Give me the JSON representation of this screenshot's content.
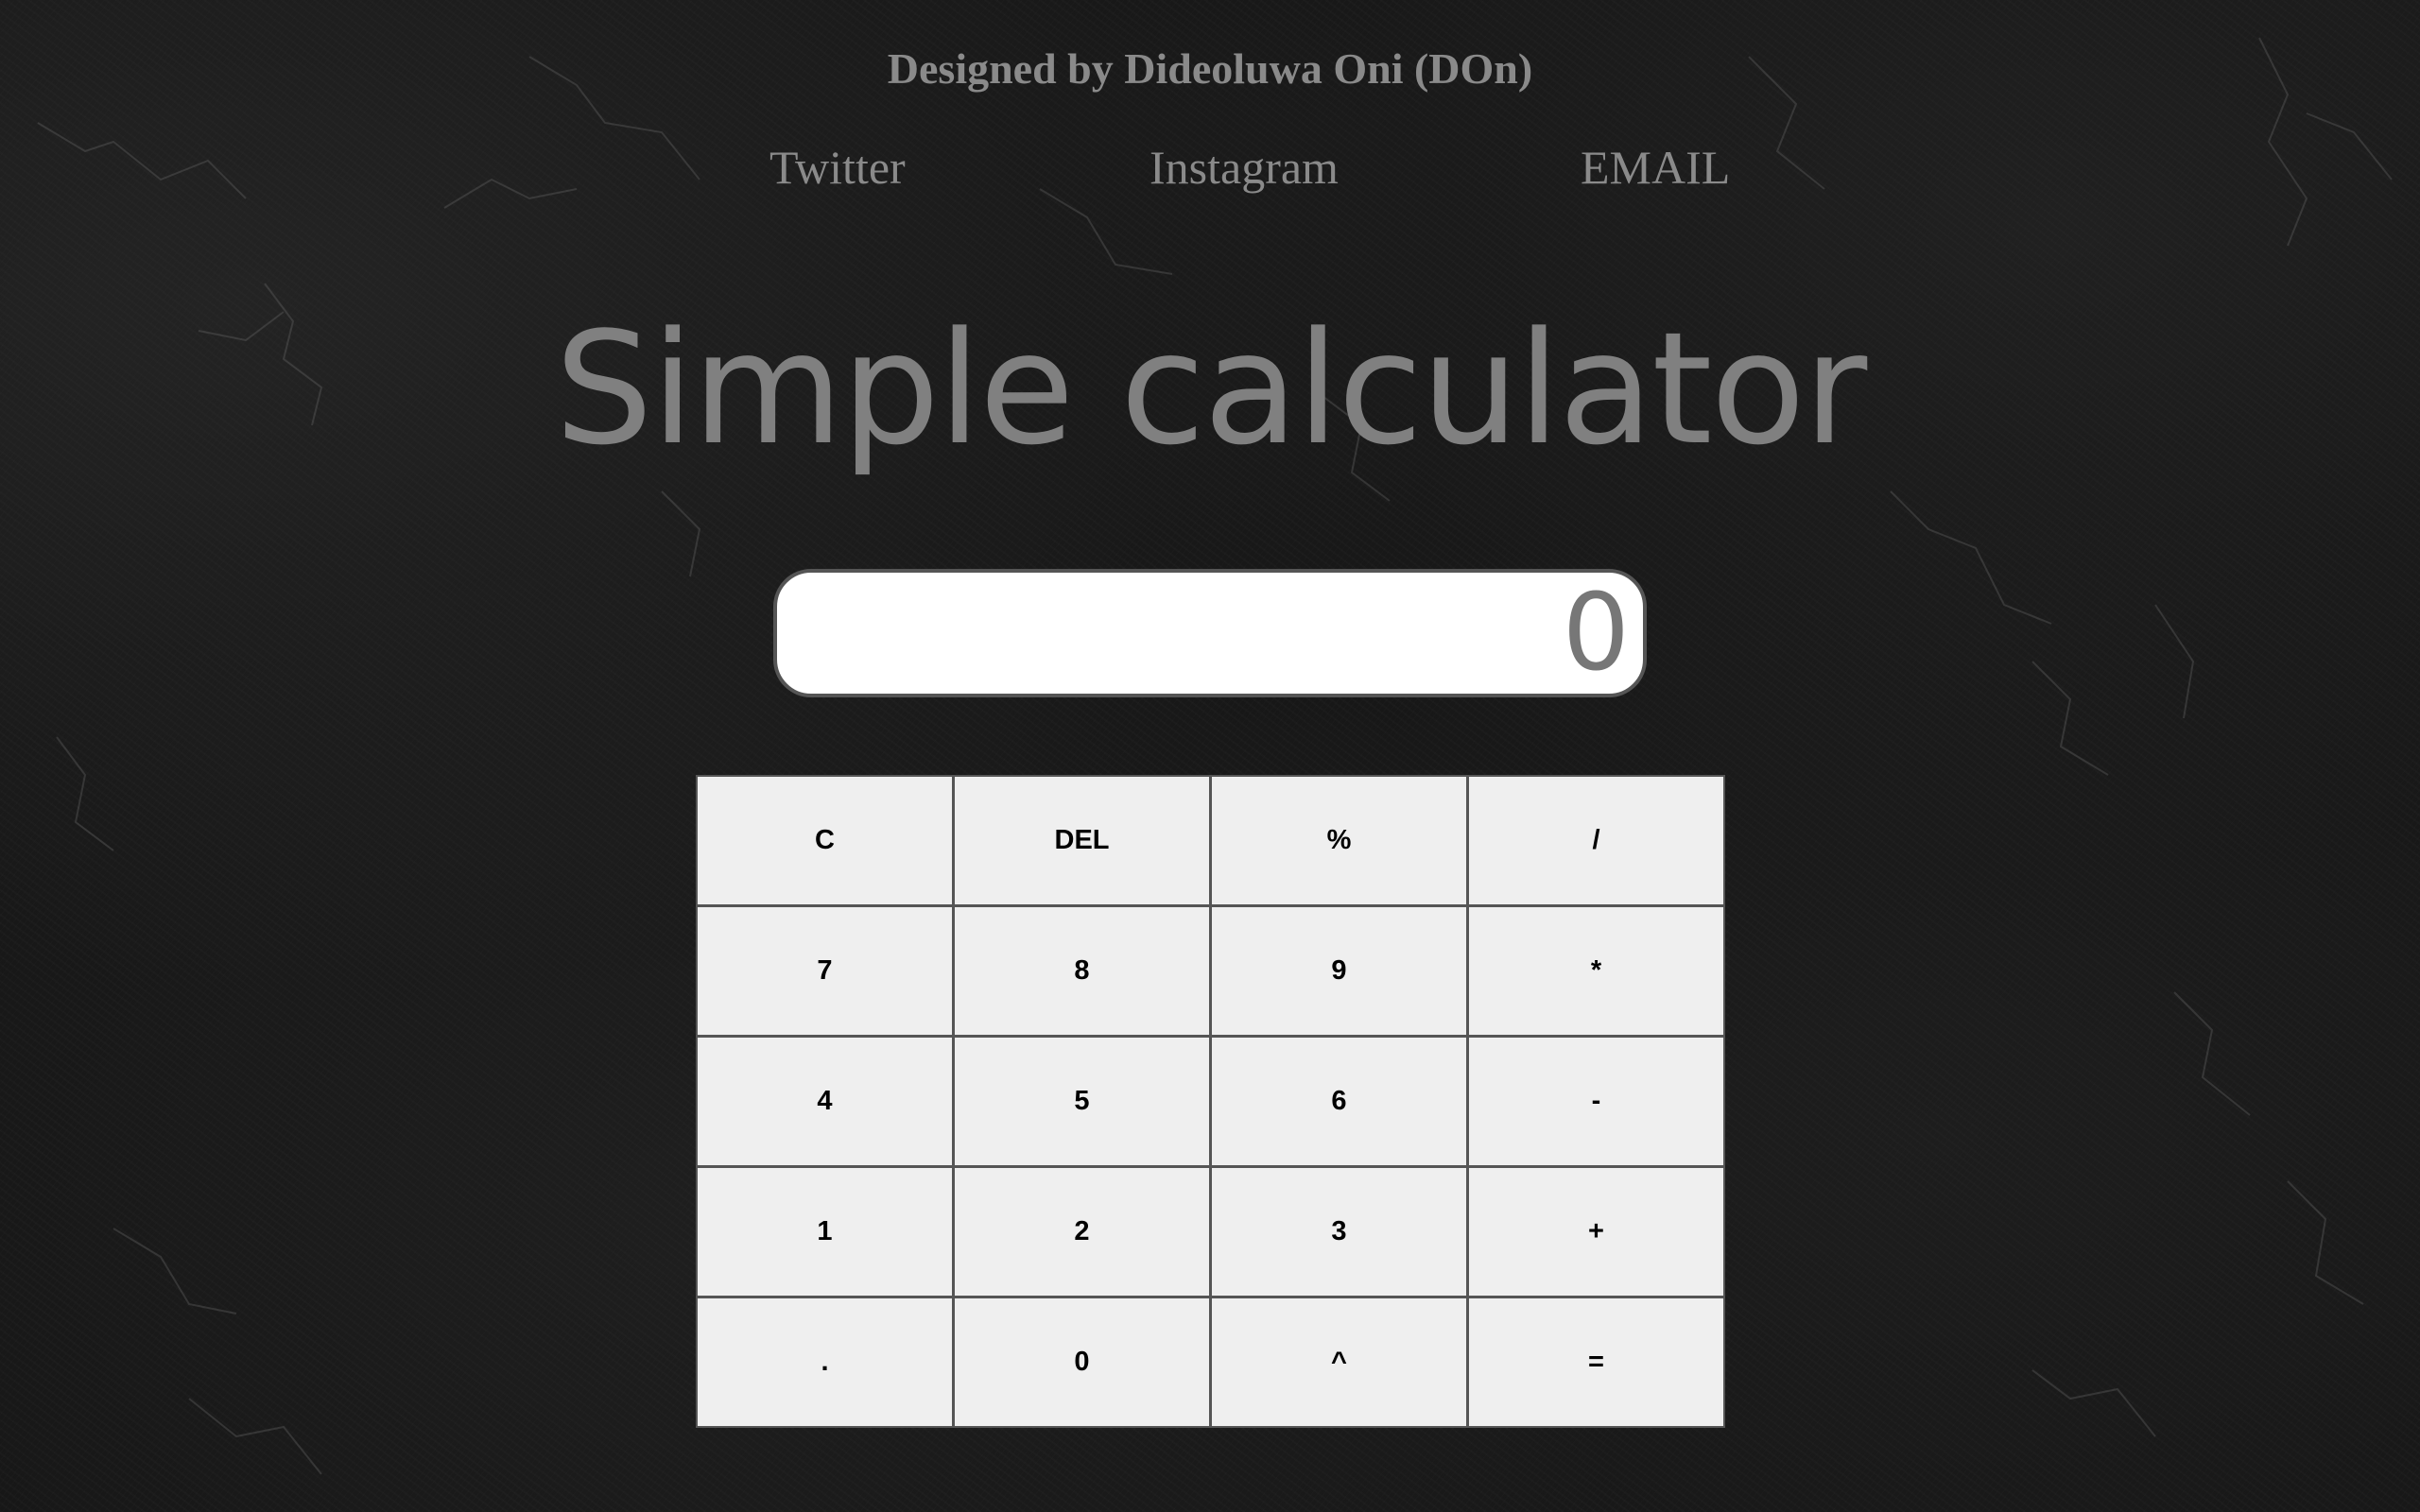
{
  "header": {
    "credit": "Designed by Dideoluwa Oni (DOn)",
    "links": {
      "twitter": "Twitter",
      "instagram": "Instagram",
      "email": "EMAIL"
    }
  },
  "main": {
    "title": "Simple calculator",
    "display_value": "0"
  },
  "keypad": {
    "keys": [
      [
        "C",
        "DEL",
        "%",
        "/"
      ],
      [
        "7",
        "8",
        "9",
        "*"
      ],
      [
        "4",
        "5",
        "6",
        "-"
      ],
      [
        "1",
        "2",
        "3",
        "+"
      ],
      [
        ".",
        "0",
        "^",
        "="
      ]
    ]
  },
  "colors": {
    "background": "#161616",
    "muted_text": "#8a8a8a",
    "key_background": "#efefef",
    "display_background": "#ffffff"
  }
}
